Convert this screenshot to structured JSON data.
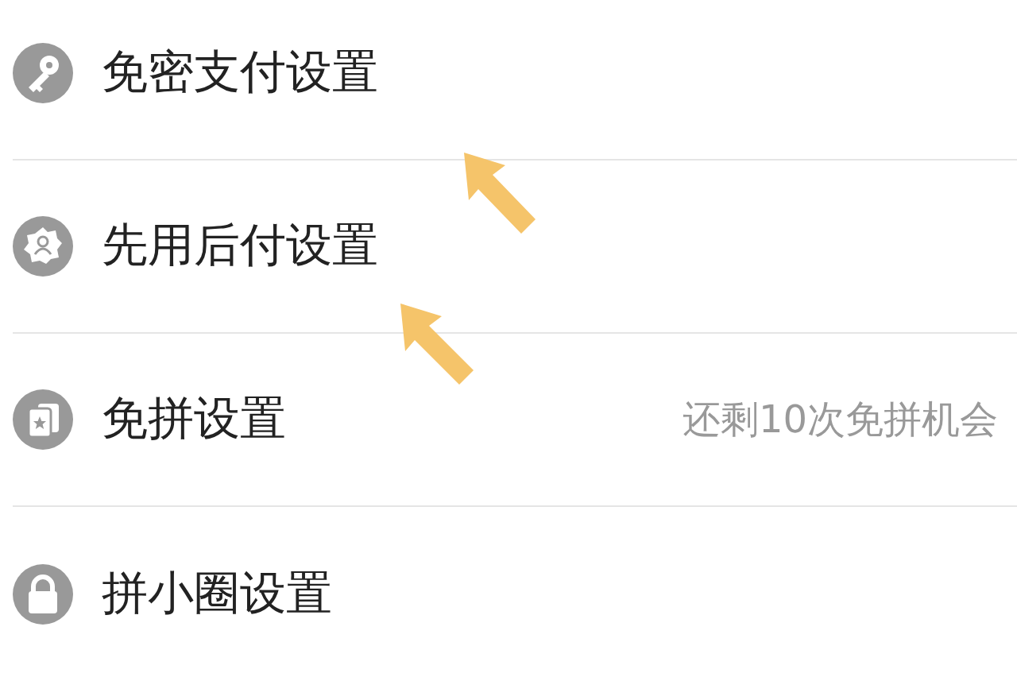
{
  "settings": [
    {
      "label": "免密支付设置"
    },
    {
      "label": "先用后付设置"
    },
    {
      "label": "免拼设置",
      "detail": "还剩10次免拼机会"
    },
    {
      "label": "拼小圈设置"
    }
  ]
}
